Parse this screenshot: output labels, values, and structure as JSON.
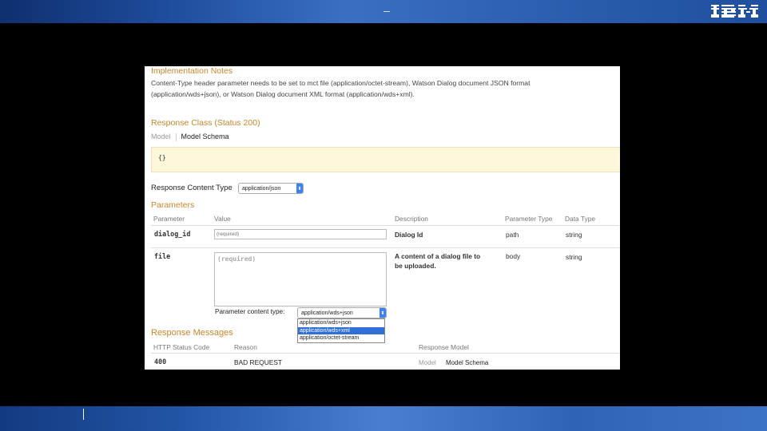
{
  "slide": {
    "logo": "IBM"
  },
  "panel": {
    "impl_title": "Implementation Notes",
    "impl_line1": "Content-Type header parameter needs to be set to mct file (application/octet-stream), Watson Dialog document JSON format",
    "impl_line2": "(application/wds+json), or Watson Dialog document XML format (application/wds+xml).",
    "response_class_title": "Response Class (Status 200)",
    "tab_model": "Model",
    "tab_model_schema": "Model Schema",
    "schema_value": "{}",
    "response_content_type_label": "Response Content Type",
    "response_content_type_value": "application/json",
    "parameters_title": "Parameters",
    "param_headers": [
      "Parameter",
      "Value",
      "Description",
      "Parameter Type",
      "Data Type"
    ],
    "params": [
      {
        "name": "dialog_id",
        "placeholder": "(required)",
        "description": "Dialog Id",
        "param_type": "path",
        "data_type": "string"
      },
      {
        "name": "file",
        "placeholder": "(required)",
        "description_line1": "A content of a dialog file to",
        "description_line2": "be uploaded.",
        "param_type": "body",
        "data_type": "string"
      }
    ],
    "param_content_type_label": "Parameter content type:",
    "param_content_type_value": "application/wds+json",
    "param_content_type_options": [
      "application/wds+json",
      "application/wds+xml",
      "application/octet-stream"
    ],
    "param_content_type_highlighted": "application/wds+xml",
    "response_messages_title": "Response Messages",
    "msg_headers": [
      "HTTP Status Code",
      "Reason",
      "Response Model"
    ],
    "messages": [
      {
        "code": "400",
        "reason": "BAD REQUEST",
        "model_tab": "Model",
        "schema_tab": "Model Schema"
      }
    ]
  },
  "colors": {
    "accent": "#c5862b",
    "schema_bg": "#fcf6db",
    "select_highlight": "#2f6fd8"
  }
}
